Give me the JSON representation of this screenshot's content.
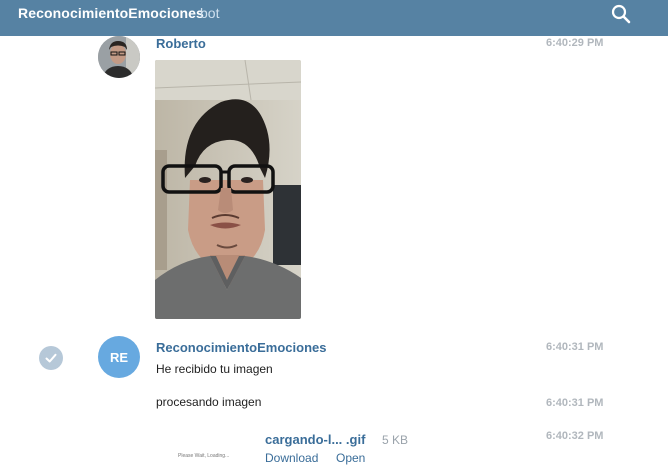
{
  "header": {
    "title": "ReconocimientoEmociones",
    "subtitle": "bot",
    "search_icon": "search-icon",
    "background": "#5682a3"
  },
  "messages": [
    {
      "author": "Roberto",
      "time": "6:40:29 PM",
      "attachment": "photo"
    },
    {
      "author": "ReconocimientoEmociones",
      "avatar_initials": "RE",
      "avatar_color": "#67a9e0",
      "time": "6:40:31 PM",
      "text": "He recibido tu imagen",
      "status_icon": "checkmark-icon"
    },
    {
      "time": "6:40:31 PM",
      "text": "procesando imagen"
    },
    {
      "time": "6:40:32 PM",
      "file": {
        "name": "cargando-l... .gif",
        "size": "5 KB",
        "download_label": "Download",
        "open_label": "Open",
        "thumb_caption": "Please Wait, Loading..."
      }
    }
  ]
}
